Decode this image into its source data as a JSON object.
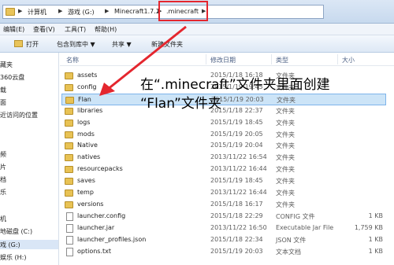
{
  "address": {
    "crumbs": [
      "计算机",
      "游戏 (G:)",
      "Minecraft1.7.2",
      ".minecraft"
    ]
  },
  "menu": [
    "编辑(E)",
    "查看(V)",
    "工具(T)",
    "帮助(H)"
  ],
  "toolbar": {
    "open": "打开",
    "include": "包含到库中 ▼",
    "share": "共享 ▼",
    "new_folder": "新建文件夹"
  },
  "nav": {
    "items": [
      "藏夹",
      "360云盘",
      "载",
      "面",
      "近访问的位置",
      "",
      "频",
      "片",
      "档",
      "乐",
      "",
      "机",
      "地磁盘 (C:)",
      "戏 (G:)",
      "娱乐 (H:)"
    ]
  },
  "columns": {
    "name": "名称",
    "date": "修改日期",
    "type": "类型",
    "size": "大小"
  },
  "files": [
    {
      "name": "assets",
      "date": "2015/1/18 16:18",
      "type": "文件夹",
      "size": "",
      "kind": "folder"
    },
    {
      "name": "config",
      "date": "2015/1/19 19:45",
      "type": "文件夹",
      "size": "",
      "kind": "folder"
    },
    {
      "name": "Flan",
      "date": "2015/1/19 20:03",
      "type": "文件夹",
      "size": "",
      "kind": "folder",
      "selected": true
    },
    {
      "name": "libraries",
      "date": "2015/1/18 22:37",
      "type": "文件夹",
      "size": "",
      "kind": "folder"
    },
    {
      "name": "logs",
      "date": "2015/1/19 18:45",
      "type": "文件夹",
      "size": "",
      "kind": "folder"
    },
    {
      "name": "mods",
      "date": "2015/1/19 20:05",
      "type": "文件夹",
      "size": "",
      "kind": "folder"
    },
    {
      "name": "Native",
      "date": "2015/1/19 20:04",
      "type": "文件夹",
      "size": "",
      "kind": "folder"
    },
    {
      "name": "natives",
      "date": "2013/11/22 16:54",
      "type": "文件夹",
      "size": "",
      "kind": "folder"
    },
    {
      "name": "resourcepacks",
      "date": "2013/11/22 16:44",
      "type": "文件夹",
      "size": "",
      "kind": "folder"
    },
    {
      "name": "saves",
      "date": "2015/1/19 18:45",
      "type": "文件夹",
      "size": "",
      "kind": "folder"
    },
    {
      "name": "temp",
      "date": "2013/11/22 16:44",
      "type": "文件夹",
      "size": "",
      "kind": "folder"
    },
    {
      "name": "versions",
      "date": "2015/1/18 16:17",
      "type": "文件夹",
      "size": "",
      "kind": "folder"
    },
    {
      "name": "launcher.config",
      "date": "2015/1/18 22:29",
      "type": "CONFIG 文件",
      "size": "1 KB",
      "kind": "file"
    },
    {
      "name": "launcher.jar",
      "date": "2013/11/22 16:50",
      "type": "Executable Jar File",
      "size": "1,759 KB",
      "kind": "file"
    },
    {
      "name": "launcher_profiles.json",
      "date": "2015/1/18 22:34",
      "type": "JSON 文件",
      "size": "1 KB",
      "kind": "file"
    },
    {
      "name": "options.txt",
      "date": "2015/1/19 20:03",
      "type": "文本文档",
      "size": "1 KB",
      "kind": "file"
    }
  ],
  "annotation": {
    "line1": "在“.minecraft”文件夹里面创建",
    "line2": "“Flan”文件夹"
  },
  "colors": {
    "highlight": "#e4262e",
    "selection": "#cce4f7",
    "folder": "#e8c254"
  }
}
